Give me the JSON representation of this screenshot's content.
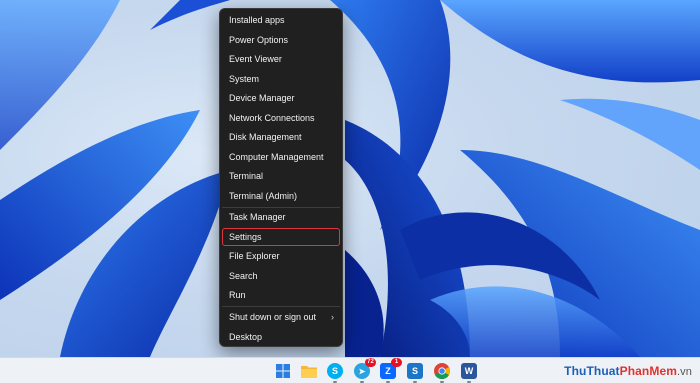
{
  "menu": {
    "items": [
      {
        "label": "Installed apps"
      },
      {
        "label": "Power Options"
      },
      {
        "label": "Event Viewer"
      },
      {
        "label": "System"
      },
      {
        "label": "Device Manager"
      },
      {
        "label": "Network Connections"
      },
      {
        "label": "Disk Management"
      },
      {
        "label": "Computer Management"
      },
      {
        "label": "Terminal"
      },
      {
        "label": "Terminal (Admin)"
      },
      {
        "label": "Task Manager"
      },
      {
        "label": "Settings",
        "highlighted": true
      },
      {
        "label": "File Explorer"
      },
      {
        "label": "Search"
      },
      {
        "label": "Run"
      },
      {
        "label": "Shut down or sign out",
        "submenu_indicator": "›"
      },
      {
        "label": "Desktop"
      }
    ],
    "highlight_color": "#e2343f"
  },
  "taskbar": {
    "icons": [
      {
        "name": "start-icon",
        "glyph": ""
      },
      {
        "name": "file-explorer-icon",
        "glyph": ""
      },
      {
        "name": "skype-icon",
        "glyph": "S"
      },
      {
        "name": "telegram-icon",
        "glyph": "➤",
        "badge": "72"
      },
      {
        "name": "zalo-icon",
        "glyph": "Z",
        "badge": "1"
      },
      {
        "name": "snagit-icon",
        "glyph": "S"
      },
      {
        "name": "chrome-icon",
        "glyph": ""
      },
      {
        "name": "word-icon",
        "glyph": "W"
      }
    ]
  },
  "watermark": {
    "part1": "ThuThuat",
    "part2": "PhanMem",
    "part3": ".vn"
  },
  "colors": {
    "menu_bg": "#202020",
    "menu_text": "#f2f2f2",
    "taskbar_bg": "#eef1f5",
    "wallpaper_blue": "#1a4fd6"
  }
}
